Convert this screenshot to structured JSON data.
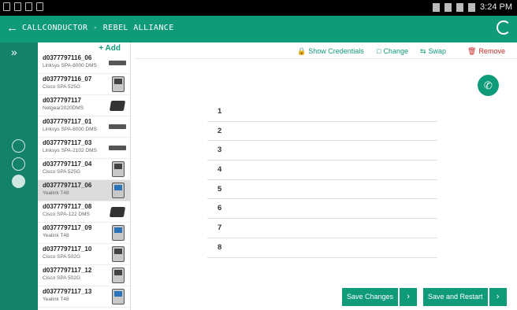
{
  "status_bar": {
    "time": "3:24 PM"
  },
  "app_bar": {
    "back_icon": "arrow-left-icon",
    "title": "CALLCONDUCTOR  -  REBEL ALLIANCE",
    "refresh_icon": "refresh-icon"
  },
  "rail": {
    "expand_icon": "double-chevron-right-icon",
    "expand_glyph": "»"
  },
  "device_panel": {
    "add_label": "+ Add",
    "devices": [
      {
        "name": "d0377797116_06",
        "model": "Linksys SPA-8000 DMS",
        "img": "bar"
      },
      {
        "name": "d0377797116_07",
        "model": "Cisco SPA 525G",
        "img": "phone"
      },
      {
        "name": "d0377797117",
        "model": "Netgear2020DMS",
        "img": "box"
      },
      {
        "name": "d0377797117_01",
        "model": "Linksys SPA-8000 DMS",
        "img": "bar"
      },
      {
        "name": "d0377797117_03",
        "model": "Linksys SPA-2102 DMS",
        "img": "bar"
      },
      {
        "name": "d0377797117_04",
        "model": "Cisco SPA 525G",
        "img": "phone"
      },
      {
        "name": "d0377797117_06",
        "model": "Yealink T48",
        "img": "phone-blue",
        "selected": true
      },
      {
        "name": "d0377797117_08",
        "model": "Cisco SPA-122 DMS",
        "img": "box"
      },
      {
        "name": "d0377797117_09",
        "model": "Yealink T48",
        "img": "phone-blue"
      },
      {
        "name": "d0377797117_10",
        "model": "Cisco SPA 502G",
        "img": "phone"
      },
      {
        "name": "d0377797117_12",
        "model": "Cisco SPA 502G",
        "img": "phone"
      },
      {
        "name": "d0377797117_13",
        "model": "Yealink T48",
        "img": "phone-blue"
      }
    ]
  },
  "toolbar": {
    "show_credentials": "Show Credentials",
    "change": "Change",
    "swap": "Swap",
    "remove": "Remove"
  },
  "lines": [
    "1",
    "2",
    "3",
    "4",
    "5",
    "6",
    "7",
    "8"
  ],
  "actions": {
    "save_changes": "Save Changes",
    "save_and_restart": "Save and Restart",
    "arrow": "›"
  },
  "colors": {
    "primary": "#0f9a7a",
    "rail": "#14826a",
    "danger": "#c62828"
  }
}
